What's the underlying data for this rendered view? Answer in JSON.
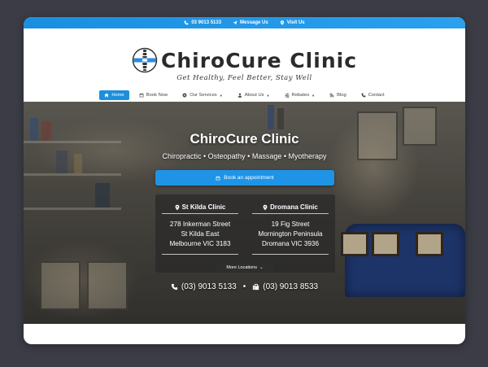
{
  "topbar": {
    "phone": "03 9013 5133",
    "message": "Message Us",
    "visit": "Visit Us"
  },
  "brand": {
    "name": "ChiroCure Clinic",
    "tagline": "Get Healthy, Feel Better, Stay Well"
  },
  "nav": {
    "items": [
      {
        "label": "Home",
        "icon": "home-icon",
        "active": true
      },
      {
        "label": "Book Now",
        "icon": "calendar-icon"
      },
      {
        "label": "Our Services",
        "icon": "gear-icon",
        "dropdown": true
      },
      {
        "label": "About Us",
        "icon": "user-icon",
        "dropdown": true
      },
      {
        "label": "Rebates",
        "icon": "sliders-icon",
        "dropdown": true
      },
      {
        "label": "Blog",
        "icon": "blog-icon"
      },
      {
        "label": "Contact",
        "icon": "phone-icon"
      }
    ]
  },
  "hero": {
    "title": "ChiroCure Clinic",
    "subtitle": "Chiropractic • Osteopathy • Massage • Myotherapy",
    "book_label": "Book an appointment",
    "locations": [
      {
        "name": "St Kilda Clinic",
        "lines": [
          "278 Inkerman Street",
          "St Kilda East",
          "Melbourne VIC 3183"
        ]
      },
      {
        "name": "Dromana Clinic",
        "lines": [
          "19 Fig Street",
          "Mornington Peninsula",
          "Dromana VIC 3936"
        ]
      }
    ],
    "more_label": "More Locations",
    "phones": [
      "(03) 9013 5133",
      "(03) 9013 8533"
    ],
    "separator": "•"
  },
  "colors": {
    "accent": "#1f94e6",
    "backdrop": "#3b3c45"
  }
}
